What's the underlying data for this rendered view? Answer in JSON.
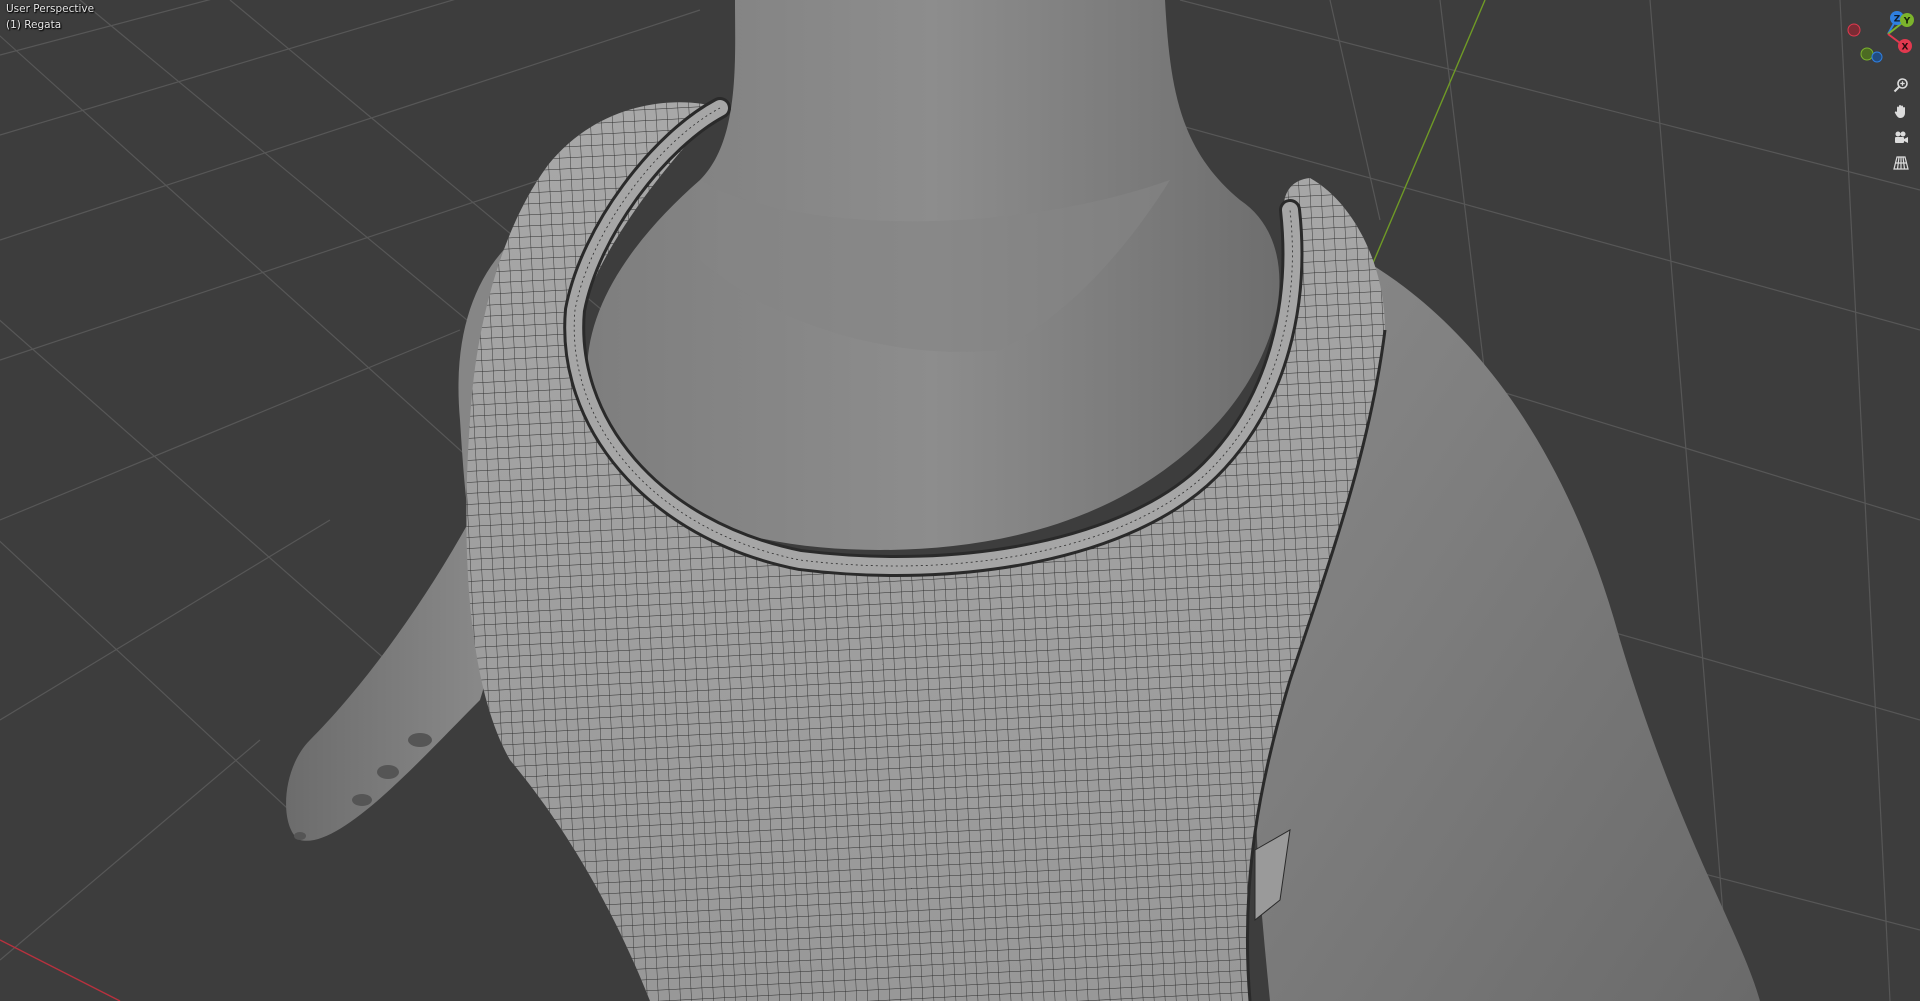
{
  "viewport": {
    "perspective_label": "User Perspective",
    "object_label": "(1) Regata"
  },
  "gizmo": {
    "axes": [
      {
        "name": "Z",
        "color": "#2f7fe0"
      },
      {
        "name": "Y",
        "color": "#7cb42c"
      },
      {
        "name": "X",
        "color": "#e2394f"
      }
    ]
  },
  "nav_buttons": [
    {
      "name": "zoom",
      "icon": "magnifier-plus-icon"
    },
    {
      "name": "pan",
      "icon": "hand-icon"
    },
    {
      "name": "camera",
      "icon": "camera-icon"
    },
    {
      "name": "perspective",
      "icon": "grid-perspective-icon"
    }
  ],
  "colors": {
    "background": "#3d3d3d",
    "grid_line": "#555555",
    "axis_x": "#b8313e",
    "axis_y": "#6f9a26",
    "mesh": "#8a8a8a",
    "wireframe": "#2a2a2a"
  }
}
